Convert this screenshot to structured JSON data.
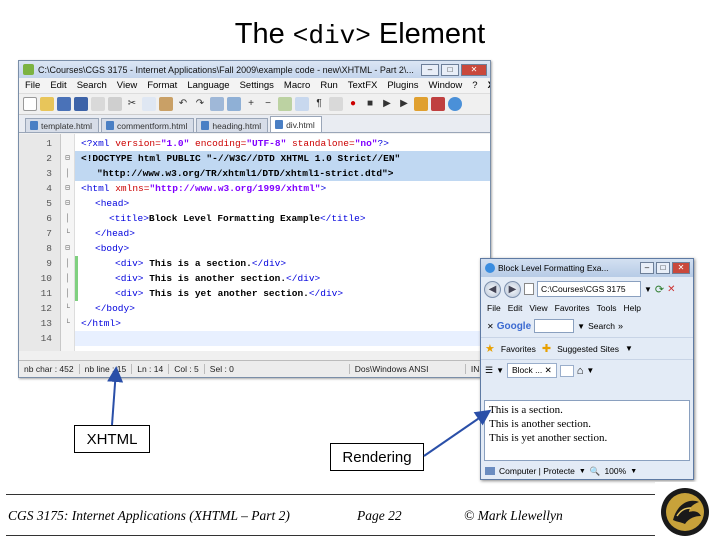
{
  "slide": {
    "title_pre": "The ",
    "title_code": "<div>",
    "title_post": " Element"
  },
  "notepad": {
    "title": "C:\\Courses\\CGS 3175 - Internet Applications\\Fall 2009\\example code - new\\XHTML - Part 2\\...",
    "menu": [
      "File",
      "Edit",
      "Search",
      "View",
      "Format",
      "Language",
      "Settings",
      "Macro",
      "Run",
      "TextFX",
      "Plugins",
      "Window",
      "?"
    ],
    "menu_close": "X",
    "tabs": [
      "template.html",
      "commentform.html",
      "heading.html",
      "div.html"
    ],
    "line_numbers": [
      "1",
      "2",
      "3",
      "4",
      "5",
      "6",
      "7",
      "8",
      "9",
      "10",
      "11",
      "12",
      "13",
      "14"
    ],
    "status": {
      "nb_char": "nb char : 452",
      "nb_line": "nb line : 15",
      "ln": "Ln : 14",
      "col": "Col : 5",
      "sel": "Sel : 0",
      "format": "Dos\\Windows  ANSI",
      "mode": "INS"
    }
  },
  "code": {
    "l1_a": "<?xml ",
    "l1_b": "version=",
    "l1_c": "\"1.0\"",
    "l1_d": " encoding=",
    "l1_e": "\"UTF-8\"",
    "l1_f": " standalone=",
    "l1_g": "\"no\"",
    "l1_h": "?>",
    "l2_a": "<!DOCTYPE html PUBLIC ",
    "l2_b": "\"-//W3C//DTD XHTML 1.0 Strict//EN\"",
    "l3_a": "\"http://www.w3.org/TR/xhtml1/DTD/xhtml1-strict.dtd\"",
    "l3_b": ">",
    "l4_a": "<html ",
    "l4_b": "xmlns=",
    "l4_c": "\"http://www.w3.org/1999/xhtml\"",
    "l4_d": ">",
    "l5": "<head>",
    "l6_a": "<title>",
    "l6_b": "Block Level Formatting Example",
    "l6_c": "</title>",
    "l7": "</head>",
    "l8": "<body>",
    "l9_a": "<div>",
    "l9_b": " This is a section.",
    "l9_c": "</div>",
    "l10_a": "<div>",
    "l10_b": " This is another section.",
    "l10_c": "</div>",
    "l11_a": "<div>",
    "l11_b": " This is yet another section.",
    "l11_c": "</div>",
    "l12": "</body>",
    "l13": "</html>"
  },
  "browser": {
    "title": "Block Level Formatting Exa...",
    "address": "C:\\Courses\\CGS 3175",
    "menu": [
      "File",
      "Edit",
      "View",
      "Favorites",
      "Tools",
      "Help"
    ],
    "google": "Google",
    "search": "Search",
    "more": "»",
    "favorites": "Favorites",
    "suggested": "Suggested Sites",
    "tab": "Block ...",
    "content": [
      "This is a section.",
      "This is another section.",
      "This is yet another section."
    ],
    "status_left": "Computer | Protecte",
    "zoom": "100%"
  },
  "labels": {
    "xhtml": "XHTML",
    "rendering": "Rendering"
  },
  "footer": {
    "course": "CGS 3175: Internet Applications (XHTML – Part 2)",
    "page": "Page 22",
    "author": "© Mark Llewellyn"
  },
  "colors": {
    "tag": "#0000dd",
    "attribute": "#cc0000",
    "value": "#8000ff",
    "selection": "#c0d8f2",
    "arrow": "#2a4fa8"
  }
}
